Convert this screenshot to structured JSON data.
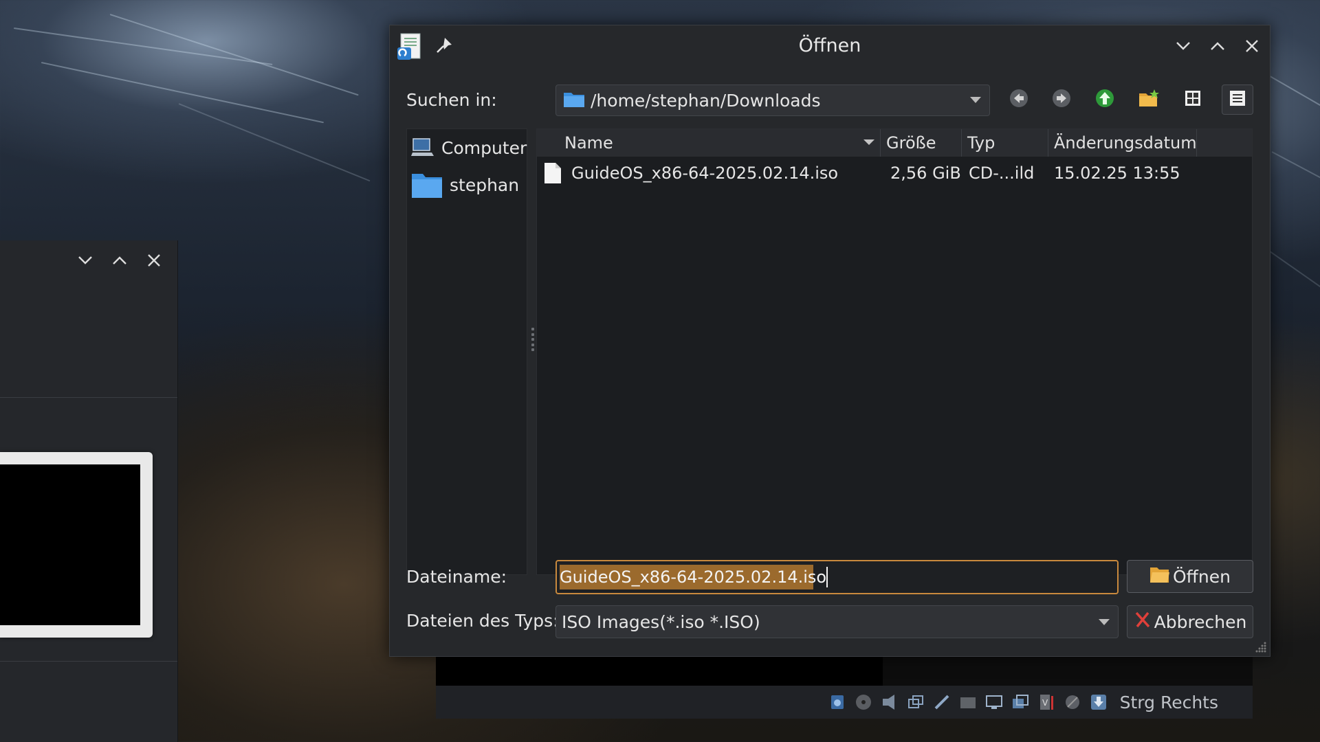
{
  "dialog": {
    "title": "Öffnen",
    "look_in_label": "Suchen in:",
    "current_path": "/home/stephan/Downloads",
    "toolbar_icons": [
      "back-arrow-icon",
      "forward-arrow-icon",
      "up-arrow-icon",
      "new-folder-icon",
      "icon-view-icon",
      "list-view-icon"
    ],
    "sidebar": [
      {
        "label": "Computer",
        "icon": "computer-icon"
      },
      {
        "label": "stephan",
        "icon": "folder-icon"
      }
    ],
    "columns": [
      "Name",
      "Größe",
      "Typ",
      "Änderungsdatum"
    ],
    "files": [
      {
        "name": "GuideOS_x86-64-2025.02.14.iso",
        "size": "2,56 GiB",
        "type": "CD-...ild",
        "modified": "15.02.25 13:55",
        "icon": "file-icon"
      }
    ],
    "filename_label": "Dateiname:",
    "filename_value": "GuideOS_x86-64-2025.02.14.iso",
    "filetype_label": "Dateien des Typs:",
    "filetype_value": "ISO Images(*.iso *.ISO)",
    "open_button": "Öffnen",
    "cancel_button": "Abbrechen"
  },
  "vm_status": {
    "host_key_text": "Strg Rechts"
  },
  "colors": {
    "accent_border": "#c9893d",
    "selection": "#9b6a2d",
    "dialog_bg": "#26282b"
  }
}
